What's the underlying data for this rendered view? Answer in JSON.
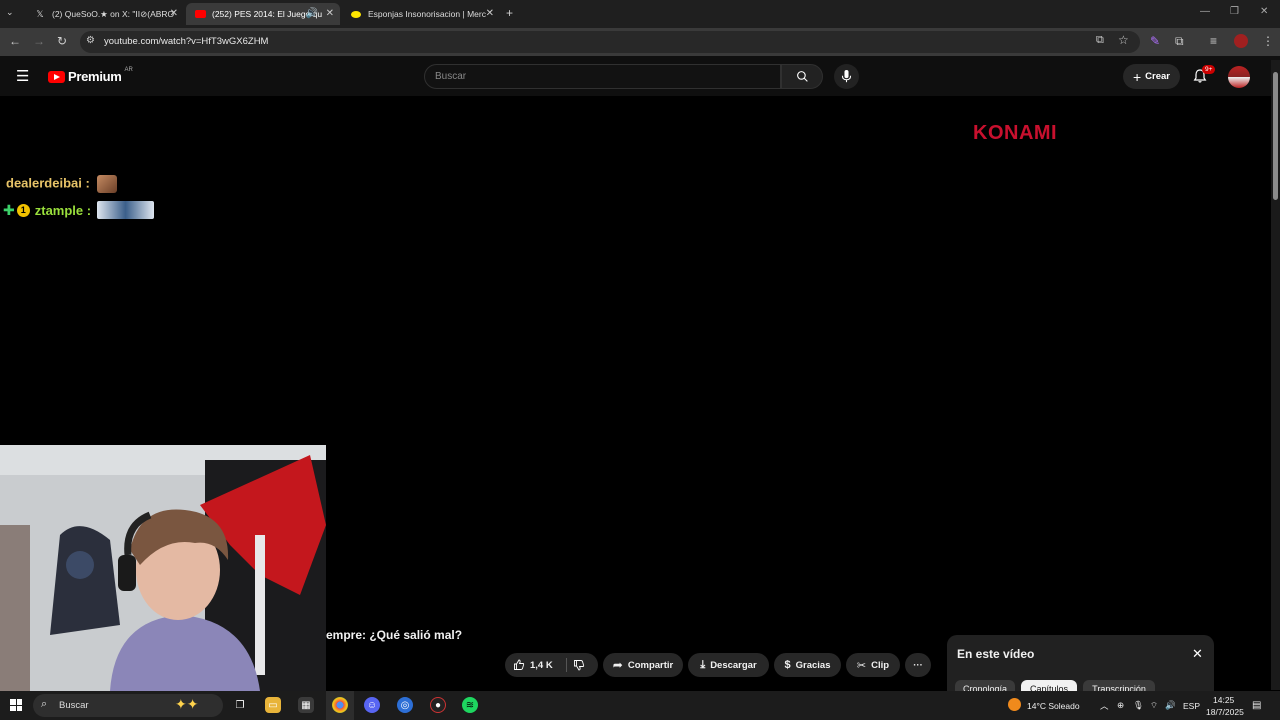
{
  "browser": {
    "tabs": [
      {
        "title": "(2) QueSoO.★ on X: \"II⊘(ABRO",
        "icon": "x-logo-icon",
        "active": false
      },
      {
        "title": "(252) PES 2014: El Juego qu",
        "icon": "youtube-icon",
        "active": true
      },
      {
        "title": "Esponjas Insonorisacion | Merc",
        "icon": "mercadolibre-icon",
        "active": false
      }
    ],
    "new_tab": "+",
    "url": "youtube.com/watch?v=HfT3wGX6ZHM"
  },
  "youtube": {
    "logo_text": "Premium",
    "region_badge": "AR",
    "search_placeholder": "Buscar",
    "create_label": "Crear",
    "notifications_badge": "9+"
  },
  "video": {
    "watermark": "KONAMI",
    "chat": [
      {
        "user": "dealerdeibai :",
        "color": "#e8c468"
      },
      {
        "user": "ztample :",
        "color": "#9adf3c"
      }
    ],
    "title_fragment": "empre: ¿Qué salió mal?"
  },
  "actions": {
    "likes": "1,4 K",
    "share": "Compartir",
    "download": "Descargar",
    "thanks": "Gracias",
    "clip": "Clip",
    "more": "···"
  },
  "panel": {
    "title": "En este vídeo",
    "tabs": [
      "Cronología",
      "Capítulos",
      "Transcripción"
    ],
    "selected": 1
  },
  "taskbar": {
    "search_placeholder": "Buscar",
    "weather": "14°C  Soleado",
    "lang": "ESP",
    "time": "14:25",
    "date": "18/7/2025"
  }
}
